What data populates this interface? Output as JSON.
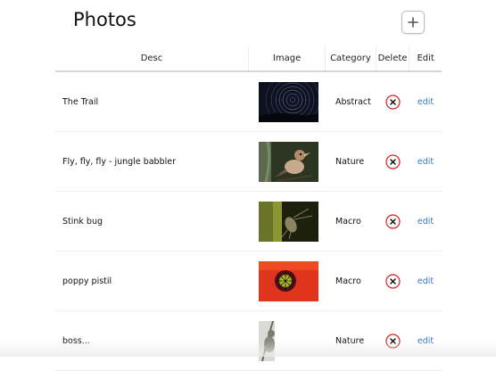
{
  "page": {
    "title": "Photos"
  },
  "toolbar": {
    "add_icon": "plus-icon"
  },
  "table": {
    "columns": [
      "Desc",
      "Image",
      "Category",
      "Delete",
      "Edit"
    ],
    "rows": [
      {
        "desc": "The Trail",
        "category": "Abstract",
        "edit": "edit",
        "image": "star-trails-photo"
      },
      {
        "desc": "Fly, fly, fly - jungle babbler",
        "category": "Nature",
        "edit": "edit",
        "image": "babbler-bird-photo"
      },
      {
        "desc": "Stink bug",
        "category": "Macro",
        "edit": "edit",
        "image": "stink-bug-photo"
      },
      {
        "desc": "poppy pistil",
        "category": "Macro",
        "edit": "edit",
        "image": "poppy-flower-photo"
      },
      {
        "desc": "boss...",
        "category": "Nature",
        "edit": "edit",
        "image": "bird-photo"
      }
    ]
  },
  "colors": {
    "delete": "#d42020",
    "link": "#3a78c3",
    "border": "#d6d6d6"
  }
}
